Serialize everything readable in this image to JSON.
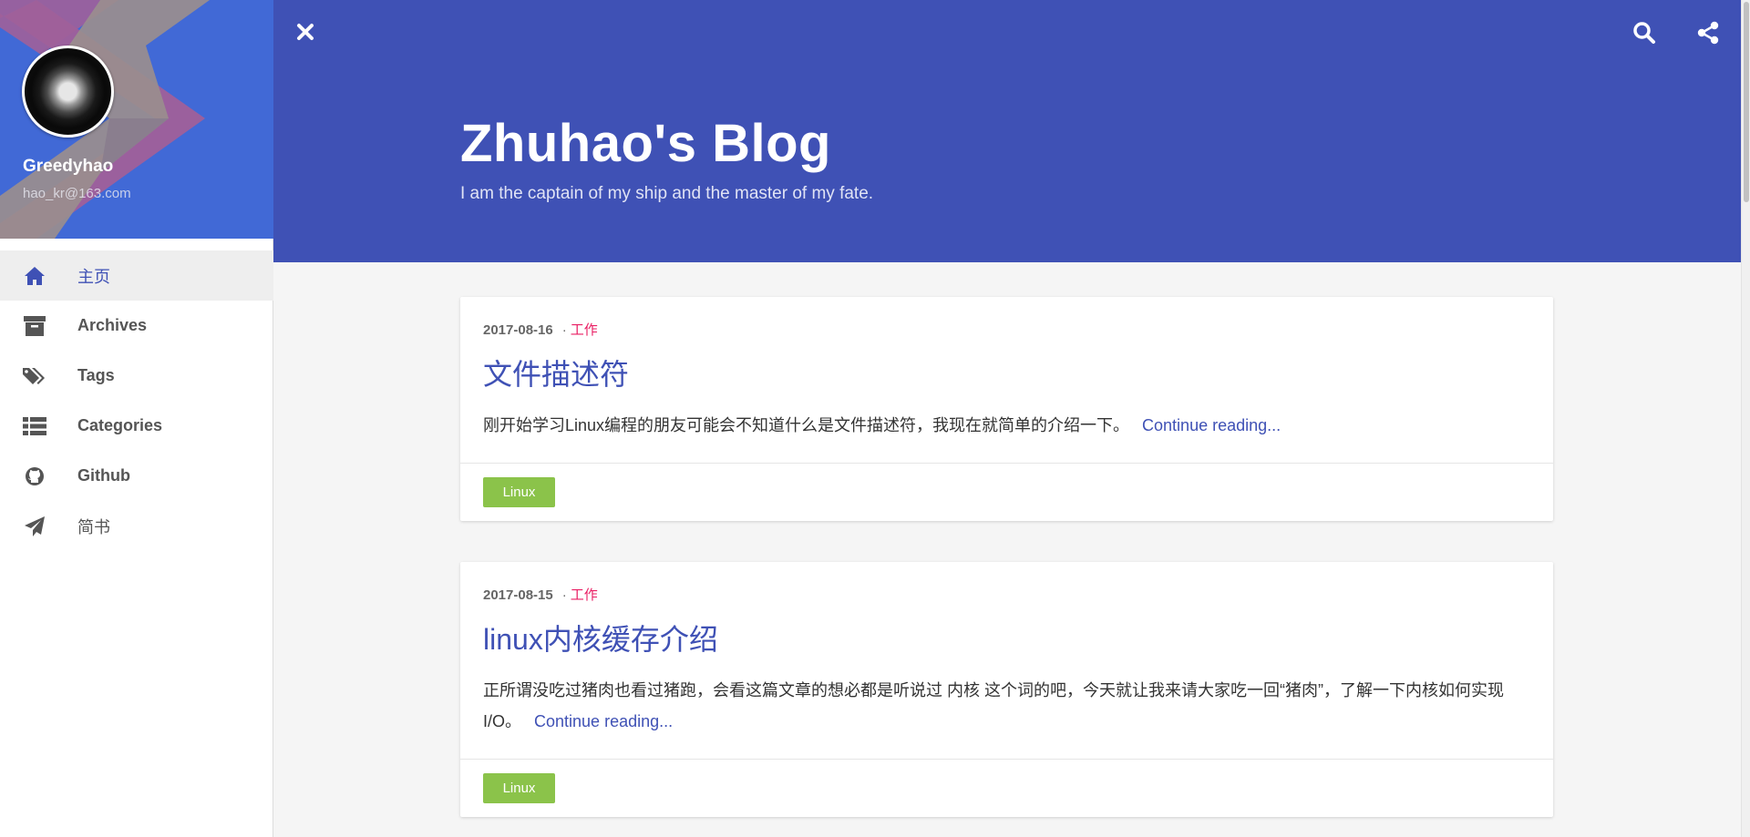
{
  "sidebar": {
    "user_name": "Greedyhao",
    "user_email": "hao_kr@163.com",
    "items": [
      {
        "label": "主页",
        "icon": "home-icon",
        "active": true
      },
      {
        "label": "Archives",
        "icon": "archive-icon",
        "active": false
      },
      {
        "label": "Tags",
        "icon": "tags-icon",
        "active": false
      },
      {
        "label": "Categories",
        "icon": "list-icon",
        "active": false
      },
      {
        "label": "Github",
        "icon": "github-icon",
        "active": false
      },
      {
        "label": "简书",
        "icon": "paper-plane-icon",
        "active": false
      }
    ]
  },
  "header": {
    "title": "Zhuhao's Blog",
    "subtitle": "I am the captain of my ship and the master of my fate.",
    "icons": [
      "close-icon",
      "search-icon",
      "share-icon"
    ]
  },
  "posts": [
    {
      "date": "2017-08-16",
      "separator": "·",
      "category": "工作",
      "title": "文件描述符",
      "excerpt": "刚开始学习Linux编程的朋友可能会不知道什么是文件描述符，我现在就简单的介绍一下。",
      "read_more": "Continue reading...",
      "tag": "Linux"
    },
    {
      "date": "2017-08-15",
      "separator": "·",
      "category": "工作",
      "title": "linux内核缓存介绍",
      "excerpt": "正所谓没吃过猪肉也看过猪跑，会看这篇文章的想必都是听说过 内核 这个词的吧，今天就让我来请大家吃一回“猪肉”，了解一下内核如何实现I/O。",
      "read_more": "Continue reading...",
      "tag": "Linux"
    }
  ],
  "colors": {
    "primary": "#3f51b5",
    "category": "#e91e63",
    "tag": "#8bc34a",
    "sidebar_header": "#4169d6"
  }
}
